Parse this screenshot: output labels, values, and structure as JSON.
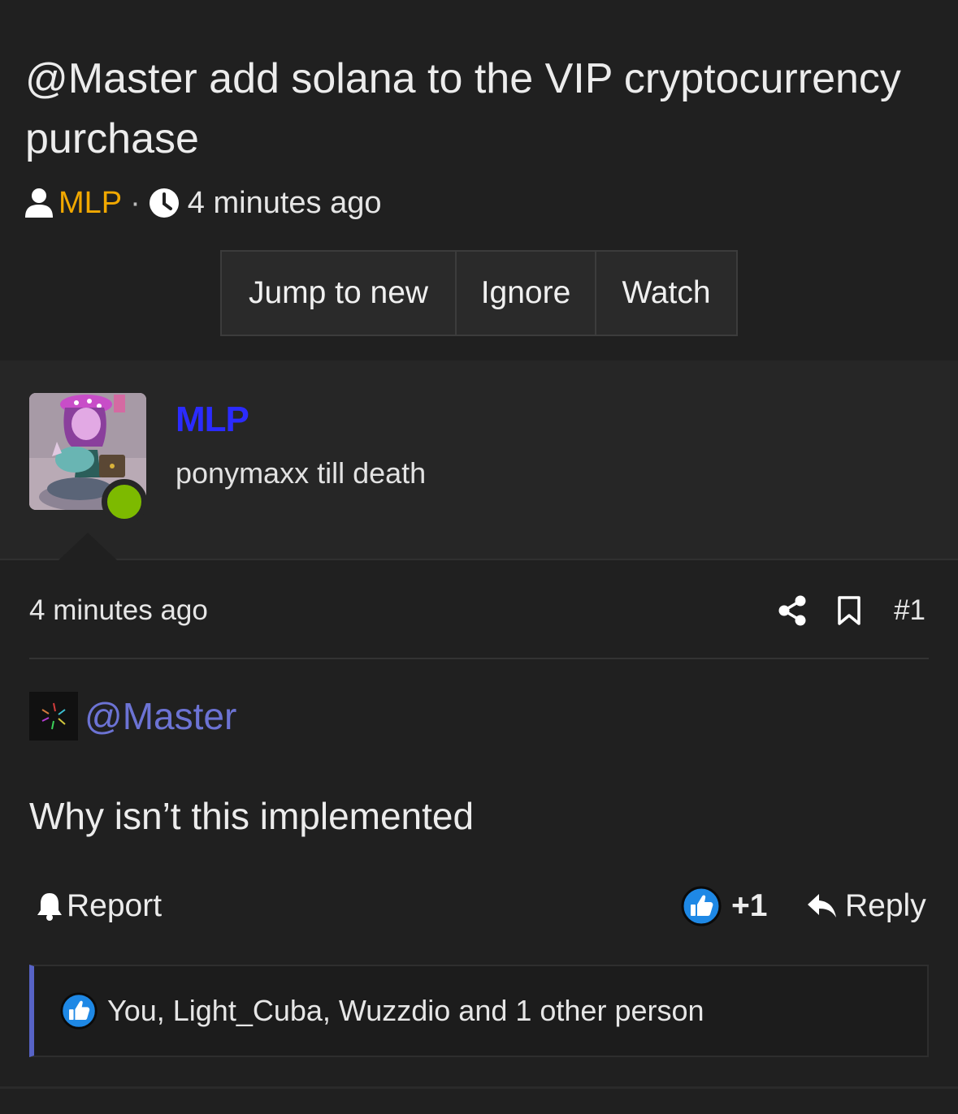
{
  "thread": {
    "title": "@Master add solana to the VIP cryptocurrency purchase",
    "author": "MLP",
    "separator": "·",
    "time": "4 minutes ago"
  },
  "thread_actions": {
    "jump_label": "Jump to new",
    "ignore_label": "Ignore",
    "watch_label": "Watch"
  },
  "post": {
    "username": "MLP",
    "user_title": "ponymaxx till death",
    "date": "4 minutes ago",
    "number": "#1",
    "mention": "@Master",
    "message": "Why isn’t this implemented",
    "report_label": "Report",
    "reaction_count": "+1",
    "reply_label": "Reply",
    "reactions_summary": "You, Light_Cuba, Wuzzdio and 1 other person"
  },
  "colors": {
    "background": "#202020",
    "author_link": "#f1a800",
    "username": "#2b2bff",
    "mention": "#6c73d4",
    "online": "#7dba00",
    "like_blue": "#1e88e5",
    "accent_border": "#5763c6"
  },
  "icons": {
    "author": "user-icon",
    "time": "clock-icon",
    "share": "share-icon",
    "bookmark": "bookmark-icon",
    "report": "bell-icon",
    "like": "thumbs-up-icon",
    "reply": "reply-arrow-icon"
  }
}
